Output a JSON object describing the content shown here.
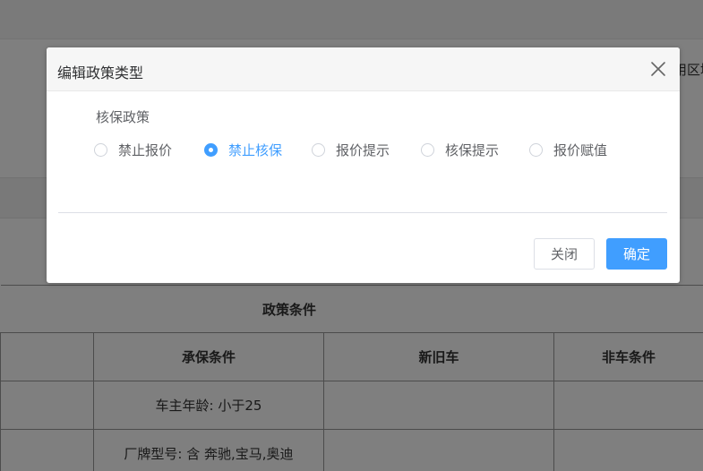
{
  "background": {
    "edge_text": "用区域",
    "table": {
      "title": "政策条件",
      "headers": [
        "",
        "承保条件",
        "新旧车",
        "非车条件"
      ],
      "rows": [
        [
          "",
          "车主年龄: 小于25",
          "",
          ""
        ],
        [
          "",
          "厂牌型号: 含 奔驰,宝马,奥迪",
          "",
          ""
        ]
      ]
    }
  },
  "dialog": {
    "title": "编辑政策类型",
    "section_label": "核保政策",
    "options": [
      {
        "label": "禁止报价",
        "checked": false
      },
      {
        "label": "禁止核保",
        "checked": true
      },
      {
        "label": "报价提示",
        "checked": false
      },
      {
        "label": "核保提示",
        "checked": false
      },
      {
        "label": "报价赋值",
        "checked": false
      }
    ],
    "close_label": "关闭",
    "confirm_label": "确定"
  },
  "colors": {
    "accent": "#409eff",
    "overlay": "rgba(0,0,0,0.5)"
  }
}
